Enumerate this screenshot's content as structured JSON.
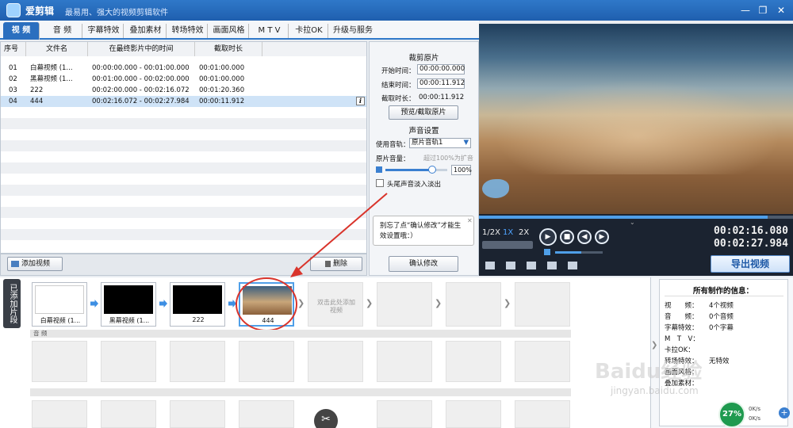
{
  "app": {
    "title": "爱剪辑",
    "slogan": "最易用、强大的视频剪辑软件"
  },
  "window": {
    "minimize": "—",
    "restore": "❐",
    "close": "✕"
  },
  "tabs": [
    "视 频",
    "音 频",
    "字幕特效",
    "叠加素材",
    "转场特效",
    "画面风格",
    "M T V",
    "卡拉OK",
    "升级与服务"
  ],
  "list": {
    "headers": [
      "序号",
      "文件名",
      "在最终影片中的时间",
      "截取时长"
    ],
    "rows": [
      {
        "no": "01",
        "name": "白幕视频 (1...",
        "time": "00:00:00.000 - 00:01:00.000",
        "dur": "00:01:00.000"
      },
      {
        "no": "02",
        "name": "黑幕视频 (1...",
        "time": "00:01:00.000 - 00:02:00.000",
        "dur": "00:01:00.000"
      },
      {
        "no": "03",
        "name": "222",
        "time": "00:02:00.000 - 00:02:16.072",
        "dur": "00:01:20.360"
      },
      {
        "no": "04",
        "name": "444",
        "time": "00:02:16.072 - 00:02:27.984",
        "dur": "00:00:11.912"
      }
    ],
    "info_icon": "i",
    "add_video": "添加视频",
    "delete": "删除"
  },
  "settings": {
    "crop_title": "裁剪原片",
    "start_label": "开始时间：",
    "start_value": "00:00:00.000",
    "end_label": "结束时间：",
    "end_value": "00:00:11.912",
    "dur_label": "截取时长：",
    "dur_value": "00:00:11.912",
    "preview_btn": "预览/截取原片",
    "audio_title": "声音设置",
    "track_label": "使用音轨：",
    "track_value": "原片音轨1",
    "vol_label": "原片音量：",
    "vol_hint": "超过100%为扩音",
    "vol_value": "100%",
    "vol_level": 0.75,
    "fade_label": "头尾声音淡入淡出",
    "tip": "别忘了点“确认修改”才能生效设置哦：）",
    "tip_close": "✕",
    "confirm": "确认修改"
  },
  "player": {
    "speeds": [
      "1/2X",
      "1X",
      "2X"
    ],
    "time_current": "00:02:16.080",
    "time_total": "00:02:27.984",
    "progress": 0.92,
    "volume": 0.55,
    "export": "导出视频"
  },
  "timeline": {
    "label": "已添加片段",
    "clips": [
      "白幕视频 (1...",
      "黑幕视频 (1...",
      "222",
      "444"
    ],
    "placeholder": "双击此处添加视频",
    "audio_track": "音 频"
  },
  "info": {
    "title": "所有制作的信息：",
    "rows": [
      {
        "k": "视　　频：",
        "v": "4个视频"
      },
      {
        "k": "音　　频：",
        "v": "0个音频"
      },
      {
        "k": "字幕特效：",
        "v": "0个字幕"
      },
      {
        "k": "M　T　V：",
        "v": ""
      },
      {
        "k": "卡拉OK：",
        "v": ""
      },
      {
        "k": "转场特效：",
        "v": "无特效"
      },
      {
        "k": "画面风格：",
        "v": ""
      },
      {
        "k": "叠加素材：",
        "v": ""
      }
    ]
  },
  "status": {
    "cpu": "27%",
    "up": "0K/s",
    "down": "0K/s"
  },
  "watermark": {
    "line1": "Baidu经验",
    "line2": "jingyan.baidu.com"
  }
}
